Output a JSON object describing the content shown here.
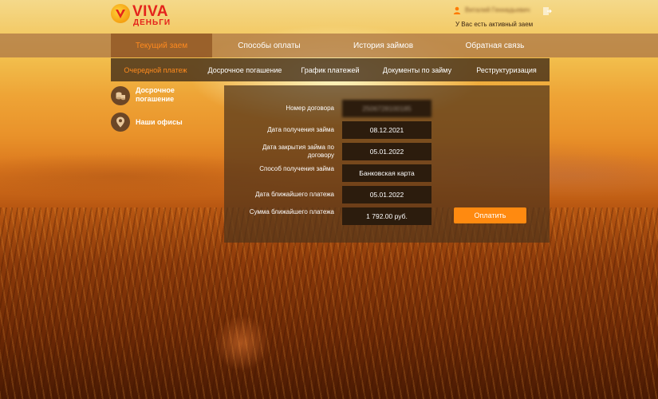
{
  "brand": {
    "logo_text": "VIVA",
    "logo_subtext": "ДЕНЬГИ",
    "accent_color": "#ff8a10",
    "logo_color": "#e4231b"
  },
  "user": {
    "name": "Виталий Геннадьевич",
    "status": "У Вас есть активный заем",
    "icon": "user-icon",
    "logout_icon": "logout-icon"
  },
  "main_nav": {
    "tabs": [
      {
        "label": "Текущий заем",
        "active": true
      },
      {
        "label": "Способы оплаты",
        "active": false
      },
      {
        "label": "История займов",
        "active": false
      },
      {
        "label": "Обратная связь",
        "active": false
      }
    ]
  },
  "sub_nav": {
    "tabs": [
      {
        "label": "Очередной платеж",
        "active": true
      },
      {
        "label": "Досрочное погашение",
        "active": false
      },
      {
        "label": "График платежей",
        "active": false
      },
      {
        "label": "Документы по займу",
        "active": false
      },
      {
        "label": "Реструктуризация",
        "active": false
      }
    ]
  },
  "side_links": [
    {
      "label": "Досрочное погашение",
      "icon": "coins-icon"
    },
    {
      "label": "Наши офисы",
      "icon": "map-pin-icon"
    }
  ],
  "loan": {
    "rows": [
      {
        "label": "Номер договора",
        "value": "2506728100185"
      },
      {
        "label": "Дата получения займа",
        "value": "08.12.2021"
      },
      {
        "label": "Дата закрытия займа по договору",
        "value": "05.01.2022"
      },
      {
        "label": "Способ получения займа",
        "value": "Банковская карта"
      },
      {
        "label": "Дата ближайшего платежа",
        "value": "05.01.2022"
      },
      {
        "label": "Сумма ближайшего платежа",
        "value": "1 792.00 руб."
      }
    ],
    "pay_button": "Оплатить"
  }
}
